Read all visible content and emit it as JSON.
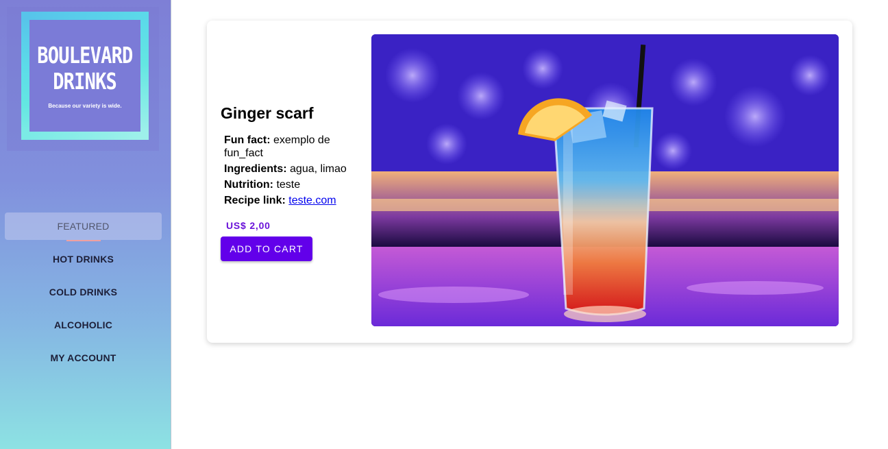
{
  "brand": {
    "title_line1": "BOULEVARD",
    "title_line2": "DRINKS",
    "tagline": "Because our variety is wide."
  },
  "nav": {
    "items": [
      {
        "label": "FEATURED",
        "active": true
      },
      {
        "label": "HOT DRINKS"
      },
      {
        "label": "COLD DRINKS"
      },
      {
        "label": "ALCOHOLIC"
      },
      {
        "label": "MY ACCOUNT"
      }
    ]
  },
  "product": {
    "name": "Ginger scarf",
    "fun_fact_label": "Fun fact:",
    "fun_fact_value": "exemplo de fun_fact",
    "ingredients_label": "Ingredients:",
    "ingredients_value": "agua, limao",
    "nutrition_label": "Nutrition:",
    "nutrition_value": "teste",
    "recipe_label": "Recipe link:",
    "recipe_link": "teste.com",
    "price": "US$ 2,00",
    "add_to_cart": "ADD TO CART",
    "image_icon": "cocktail-photo"
  },
  "colors": {
    "accent": "#6200ea",
    "price": "#6a12d9",
    "link": "#0000ee"
  }
}
